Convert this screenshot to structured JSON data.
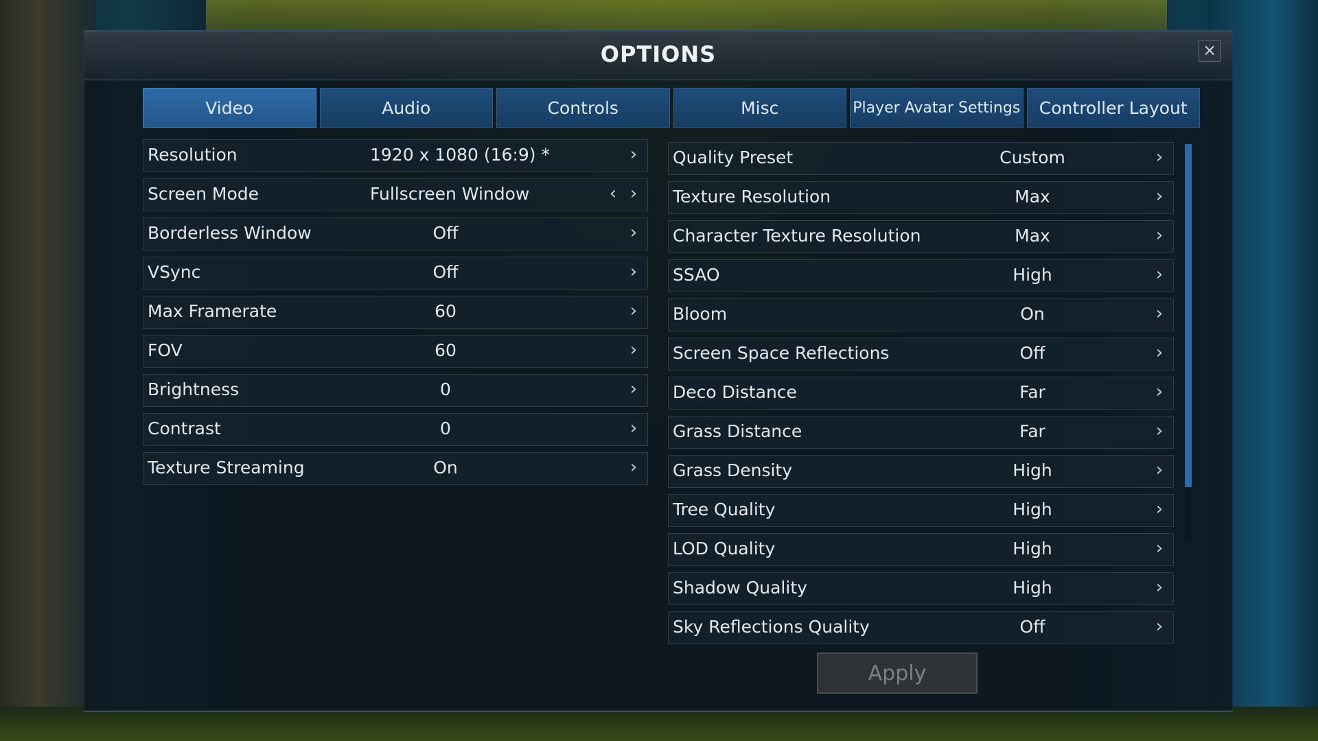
{
  "window": {
    "title": "OPTIONS",
    "close_symbol": "×"
  },
  "tabs": [
    {
      "label": "Video",
      "active": true
    },
    {
      "label": "Audio",
      "active": false
    },
    {
      "label": "Controls",
      "active": false
    },
    {
      "label": "Misc",
      "active": false
    },
    {
      "label": "Player Avatar Settings",
      "active": false
    },
    {
      "label": "Controller Layout",
      "active": false
    }
  ],
  "left_settings": [
    {
      "label": "Resolution",
      "value": "1920 x 1080  (16:9)  *"
    },
    {
      "label": "Screen Mode",
      "value": "Fullscreen Window"
    },
    {
      "label": "Borderless Window",
      "value": "Off"
    },
    {
      "label": "VSync",
      "value": "Off"
    },
    {
      "label": "Max Framerate",
      "value": "60"
    },
    {
      "label": "FOV",
      "value": "60"
    },
    {
      "label": "Brightness",
      "value": "0"
    },
    {
      "label": "Contrast",
      "value": "0"
    },
    {
      "label": "Texture Streaming",
      "value": "On"
    }
  ],
  "right_settings": [
    {
      "label": "Quality Preset",
      "value": "Custom"
    },
    {
      "label": "Texture Resolution",
      "value": "Max"
    },
    {
      "label": "Character Texture Resolution",
      "value": "Max"
    },
    {
      "label": "SSAO",
      "value": "High"
    },
    {
      "label": "Bloom",
      "value": "On"
    },
    {
      "label": "Screen Space Reflections",
      "value": "Off"
    },
    {
      "label": "Deco Distance",
      "value": "Far"
    },
    {
      "label": "Grass Distance",
      "value": "Far"
    },
    {
      "label": "Grass Density",
      "value": "High"
    },
    {
      "label": "Tree Quality",
      "value": "High"
    },
    {
      "label": "LOD Quality",
      "value": "High"
    },
    {
      "label": "Shadow Quality",
      "value": "High"
    },
    {
      "label": "Sky Reflections Quality",
      "value": "Off"
    }
  ],
  "icons": {
    "next": "chevron-right-icon",
    "prev": "chevron-left-icon",
    "close": "close-icon"
  },
  "arrows": {
    "next": "›",
    "prev": "‹"
  },
  "apply_label": "Apply",
  "colors": {
    "tab_active": "#2f6aa6",
    "tab": "#1f4d7a",
    "scroll_thumb": "#2c6aa8"
  }
}
